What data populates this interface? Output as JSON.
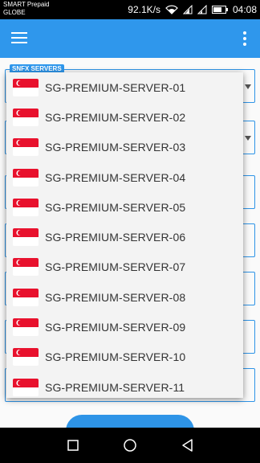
{
  "status_bar": {
    "carrier_line1": "SMART Prepaid",
    "carrier_line2": "GLOBE",
    "speed": "92.1K/s",
    "time": "04:08"
  },
  "app_bar": {
    "menu_icon": "hamburger-menu",
    "overflow_icon": "three-dots-vertical"
  },
  "form": {
    "server_field_label": "SNFX SERVERS"
  },
  "dropdown": {
    "flag_icon": "singapore-flag",
    "items": [
      {
        "label": "SG-PREMIUM-SERVER-01"
      },
      {
        "label": "SG-PREMIUM-SERVER-02"
      },
      {
        "label": "SG-PREMIUM-SERVER-03"
      },
      {
        "label": "SG-PREMIUM-SERVER-04"
      },
      {
        "label": "SG-PREMIUM-SERVER-05"
      },
      {
        "label": "SG-PREMIUM-SERVER-06"
      },
      {
        "label": "SG-PREMIUM-SERVER-07"
      },
      {
        "label": "SG-PREMIUM-SERVER-08"
      },
      {
        "label": "SG-PREMIUM-SERVER-09"
      },
      {
        "label": "SG-PREMIUM-SERVER-10"
      },
      {
        "label": "SG-PREMIUM-SERVER-11"
      }
    ]
  },
  "colors": {
    "accent": "#2f97ec",
    "flag_red": "#e8112d",
    "popup_bg": "#f3f3f3"
  }
}
